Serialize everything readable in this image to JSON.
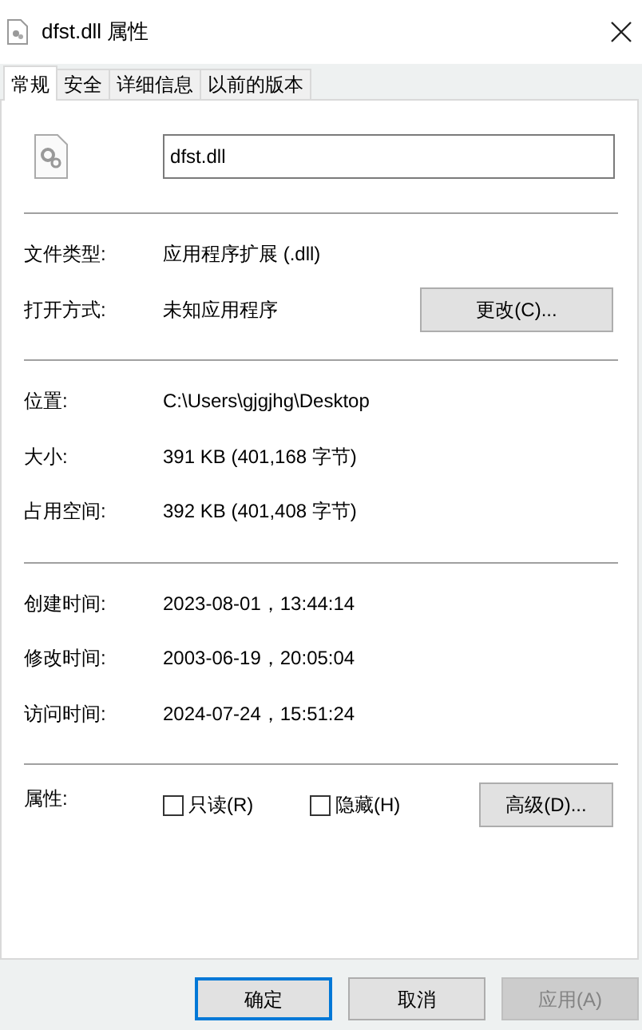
{
  "window": {
    "title": "dfst.dll 属性"
  },
  "tabs": [
    {
      "label": "常规",
      "selected": true
    },
    {
      "label": "安全",
      "selected": false
    },
    {
      "label": "详细信息",
      "selected": false
    },
    {
      "label": "以前的版本",
      "selected": false
    }
  ],
  "file_name": "dfst.dll",
  "groups": [
    [
      {
        "label": "文件类型:",
        "value": "应用程序扩展 (.dll)"
      },
      {
        "label": "打开方式:",
        "value": "未知应用程序",
        "button": "更改(C)..."
      }
    ],
    [
      {
        "label": "位置:",
        "value": "C:\\Users\\gjgjhg\\Desktop"
      },
      {
        "label": "大小:",
        "value": "391 KB (401,168 字节)"
      },
      {
        "label": "占用空间:",
        "value": "392 KB (401,408 字节)"
      }
    ],
    [
      {
        "label": "创建时间:",
        "value": "2023-08-01，13:44:14"
      },
      {
        "label": "修改时间:",
        "value": "2003-06-19，20:05:04"
      },
      {
        "label": "访问时间:",
        "value": "2024-07-24，15:51:24"
      }
    ]
  ],
  "attributes": {
    "label": "属性:",
    "checkboxes": [
      {
        "label": "只读(R)",
        "checked": false
      },
      {
        "label": "隐藏(H)",
        "checked": false
      }
    ],
    "button": "高级(D)..."
  },
  "buttons": [
    {
      "label": "确定",
      "kind": "default"
    },
    {
      "label": "取消",
      "kind": "normal"
    },
    {
      "label": "应用(A)",
      "kind": "disabled"
    }
  ]
}
